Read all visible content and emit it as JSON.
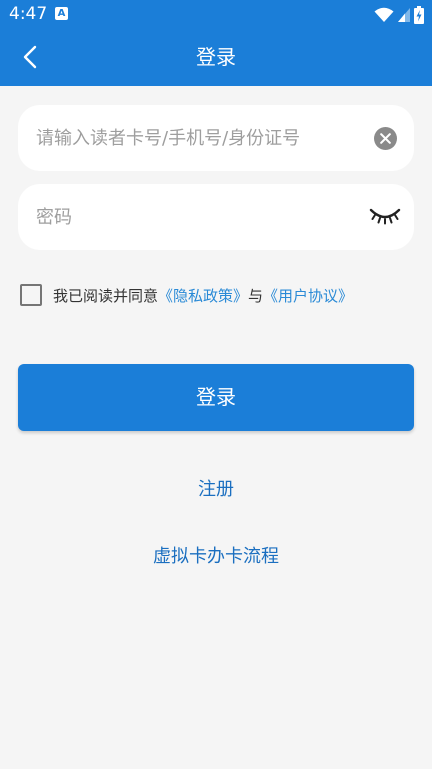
{
  "status_bar": {
    "time": "4:47",
    "notification_letter": "A"
  },
  "app_bar": {
    "title": "登录"
  },
  "form": {
    "account_placeholder": "请输入读者卡号/手机号/身份证号",
    "account_value": "",
    "password_placeholder": "密码",
    "password_value": ""
  },
  "agreement": {
    "text_prefix": "我已阅读并同意",
    "privacy_link": "《隐私政策》",
    "conjunction": "与",
    "user_agreement_link": "《用户协议》",
    "checked": false
  },
  "buttons": {
    "login": "登录",
    "register": "注册",
    "virtual_card": "虚拟卡办卡流程"
  },
  "colors": {
    "primary": "#1b7ed8",
    "link": "#2a8ad6",
    "background": "#f5f5f5"
  },
  "icons": [
    "back-arrow-icon",
    "clear-icon",
    "eye-closed-icon",
    "wifi-icon",
    "signal-icon",
    "battery-icon"
  ]
}
